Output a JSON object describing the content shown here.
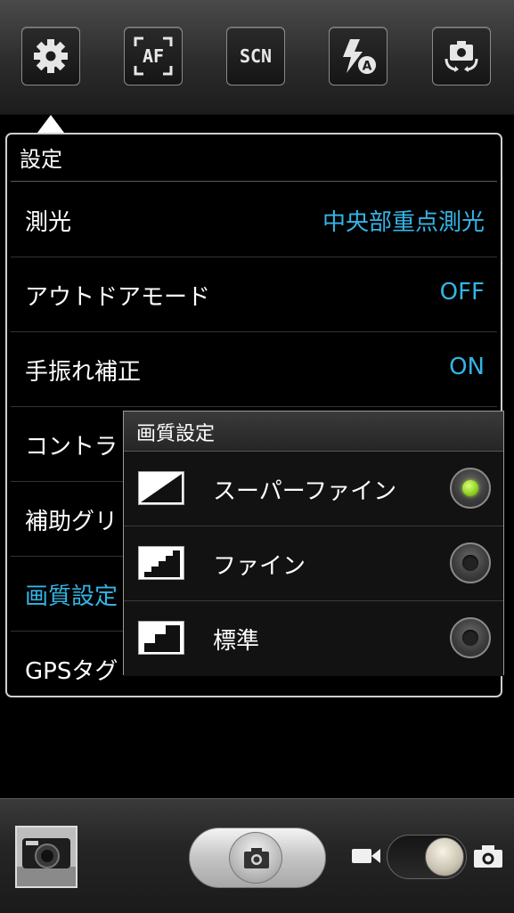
{
  "toolbar": {
    "settings_icon": "gear-icon",
    "af_label": "AF",
    "scn_label": "SCN",
    "flash_icon": "flash-auto-icon",
    "flash_badge": "A",
    "camera_switch_icon": "camera-switch-icon"
  },
  "settings": {
    "title": "設定",
    "rows": [
      {
        "label": "測光",
        "value": "中央部重点測光"
      },
      {
        "label": "アウトドアモード",
        "value": "OFF"
      },
      {
        "label": "手振れ補正",
        "value": "ON"
      },
      {
        "label": "コントラ",
        "value": ""
      },
      {
        "label": "補助グリ",
        "value": ""
      },
      {
        "label": "画質設定",
        "value": ""
      },
      {
        "label": "GPSタグ",
        "value": ""
      }
    ]
  },
  "quality_popup": {
    "title": "画質設定",
    "options": [
      {
        "label": "スーパーファイン",
        "icon": "quality-superfine-icon",
        "selected": true
      },
      {
        "label": "ファイン",
        "icon": "quality-fine-icon",
        "selected": false
      },
      {
        "label": "標準",
        "icon": "quality-normal-icon",
        "selected": false
      }
    ]
  },
  "bottom": {
    "thumbnail": "gallery-thumbnail",
    "shutter_icon": "camera-icon",
    "mode_left_icon": "video-icon",
    "mode_right_icon": "camera-icon"
  },
  "colors": {
    "accent": "#33b5e5",
    "selected_radio": "#8fd11f"
  }
}
